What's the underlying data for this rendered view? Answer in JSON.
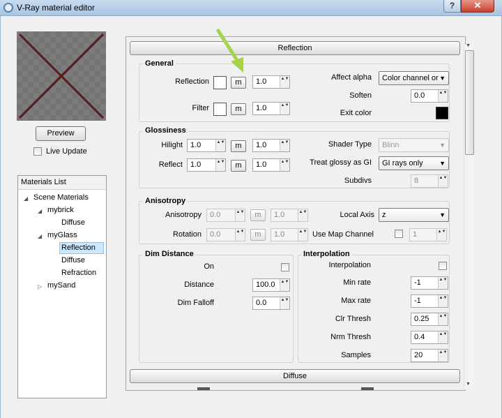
{
  "window": {
    "title": "V-Ray material editor",
    "help_label": "?",
    "close_label": "✕"
  },
  "preview": {
    "button_label": "Preview",
    "live_update_label": "Live Update"
  },
  "materials": {
    "header": "Materials List",
    "tree": [
      {
        "label": "Scene Materials",
        "expanded": true
      },
      {
        "label": "mybrick",
        "expanded": true
      },
      {
        "label": "Diffuse"
      },
      {
        "label": "myGlass",
        "expanded": true
      },
      {
        "label": "Reflection",
        "selected": true
      },
      {
        "label": "Diffuse"
      },
      {
        "label": "Refraction"
      },
      {
        "label": "mySand",
        "expanded": false
      }
    ]
  },
  "reflection": {
    "rollout_title": "Reflection",
    "general": {
      "title": "General",
      "reflection_label": "Reflection",
      "reflection_value": "1.0",
      "filter_label": "Filter",
      "filter_value": "1.0",
      "map_label": "m",
      "affect_alpha_label": "Affect alpha",
      "affect_alpha_value": "Color channel or",
      "soften_label": "Soften",
      "soften_value": "0.0",
      "exit_color_label": "Exit color"
    },
    "glossiness": {
      "title": "Glossiness",
      "hilight_label": "Hilight",
      "hilight_value": "1.0",
      "hilight_value2": "1.0",
      "reflect_label": "Reflect",
      "reflect_value": "1.0",
      "reflect_value2": "1.0",
      "shader_type_label": "Shader Type",
      "shader_type_value": "Blinn",
      "treat_glossy_label": "Treat glossy as GI",
      "treat_glossy_value": "GI rays only",
      "subdivs_label": "Subdivs",
      "subdivs_value": "8"
    },
    "anisotropy": {
      "title": "Anisotropy",
      "anisotropy_label": "Anisotropy",
      "anisotropy_value": "0.0",
      "anisotropy_value2": "1.0",
      "rotation_label": "Rotation",
      "rotation_value": "0.0",
      "rotation_value2": "1.0",
      "local_axis_label": "Local Axis",
      "local_axis_value": "z",
      "use_map_channel_label": "Use Map Channel",
      "map_channel_value": "1"
    },
    "dim_distance": {
      "title": "Dim Distance",
      "on_label": "On",
      "distance_label": "Distance",
      "distance_value": "100.0",
      "dim_falloff_label": "Dim Falloff",
      "dim_falloff_value": "0.0"
    },
    "interpolation": {
      "title": "Interpolation",
      "interpolation_label": "Interpolation",
      "min_rate_label": "Min rate",
      "min_rate_value": "-1",
      "max_rate_label": "Max rate",
      "max_rate_value": "-1",
      "clr_thresh_label": "Clr Thresh",
      "clr_thresh_value": "0.25",
      "nrm_thresh_label": "Nrm Thresh",
      "nrm_thresh_value": "0.4",
      "samples_label": "Samples",
      "samples_value": "20"
    }
  },
  "diffuse": {
    "rollout_title": "Diffuse"
  },
  "colors": {
    "exit_color": "#000000",
    "accent_arrow": "#a6d34a",
    "selection": "#cce8ff",
    "swatch_x": "#5a1a1a"
  },
  "icons": {
    "up_down": "▲▼",
    "caret": "▼",
    "tree_expanded": "◢",
    "tree_collapsed": "▷"
  }
}
